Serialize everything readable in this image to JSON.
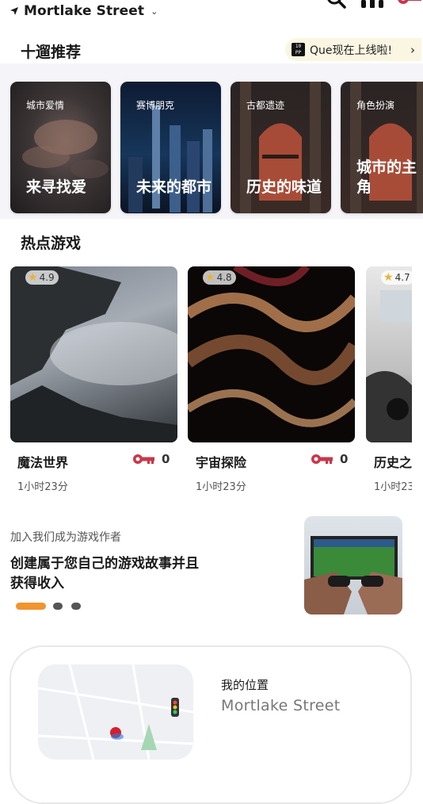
{
  "header": {
    "location": "Mortlake Street"
  },
  "recommend": {
    "title": "十遛推荐",
    "promo_pill": "Que现在上线啦!",
    "promo_badge": "10\nPP",
    "cards": [
      {
        "tag": "城市爱情",
        "title": "来寻找爱"
      },
      {
        "tag": "赛博朋克",
        "title": "未来的都市"
      },
      {
        "tag": "古都遗迹",
        "title": "历史的味道"
      },
      {
        "tag": "角色扮演",
        "title": "城市的主角"
      }
    ]
  },
  "hot": {
    "title": "热点游戏",
    "games": [
      {
        "rating": "4.9",
        "name": "魔法世界",
        "keys": "0",
        "duration": "1小时23分"
      },
      {
        "rating": "4.8",
        "name": "宇宙探险",
        "keys": "0",
        "duration": "1小时23分"
      },
      {
        "rating": "4.7",
        "name": "历史之",
        "keys": "",
        "duration": "1小时23"
      }
    ]
  },
  "promo": {
    "subtitle": "加入我们成为游戏作者",
    "title_line1": "创建属于您自己的游戏故事并且",
    "title_line2": "获得收入",
    "carousel": {
      "count": 3,
      "active": 0
    }
  },
  "location_card": {
    "label": "我的位置",
    "value": "Mortlake Street"
  },
  "colors": {
    "accent_red": "#c8374a",
    "carousel_active": "#f0952f",
    "carousel_inactive": "#555555",
    "star": "#e9b23a"
  },
  "icons": [
    "location-arrow-icon",
    "chevron-down-icon",
    "search-icon",
    "headset-icon",
    "key-icon",
    "star-icon",
    "chevron-right-icon",
    "traffic-light-icon",
    "map-pin-icon"
  ]
}
